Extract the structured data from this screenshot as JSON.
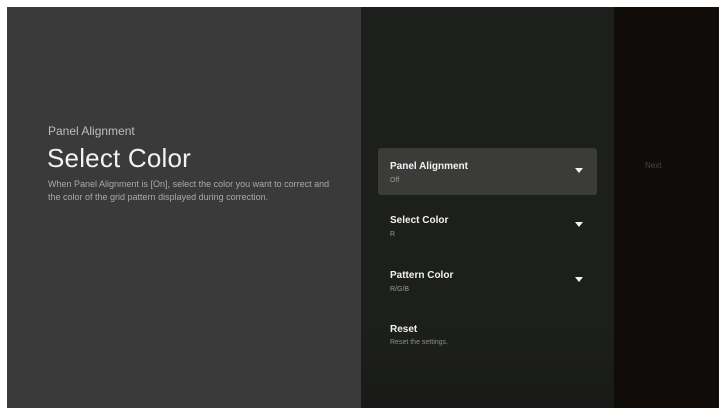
{
  "left": {
    "breadcrumb": "Panel Alignment",
    "title": "Select Color",
    "description": "When Panel Alignment is [On], select the color you want to correct and the color of the grid pattern displayed during correction."
  },
  "menu": {
    "items": [
      {
        "label": "Panel Alignment",
        "value": "Off",
        "icon": "chevron-down-icon",
        "focused": true
      },
      {
        "label": "Select Color",
        "value": "R",
        "icon": "chevron-down-icon",
        "focused": false
      },
      {
        "label": "Pattern Color",
        "value": "R/G/B",
        "icon": "chevron-down-icon",
        "focused": false
      },
      {
        "label": "Reset",
        "value": "Reset the settings.",
        "focused": false
      }
    ]
  },
  "next_panel": {
    "label": "Next"
  }
}
